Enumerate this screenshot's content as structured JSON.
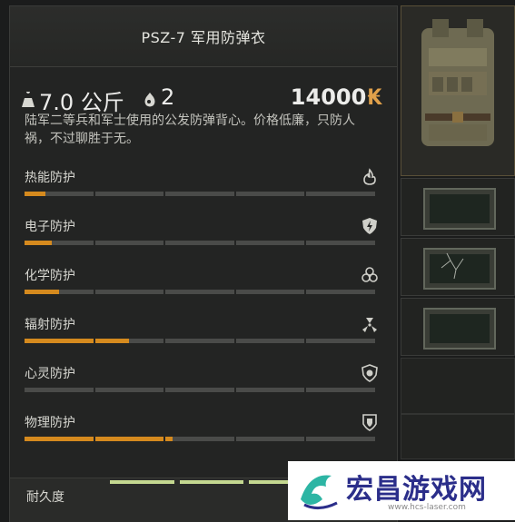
{
  "item": {
    "name": "PSZ-7 军用防弹衣",
    "weight": "7.0 公斤",
    "slots": "2",
    "price": "14000",
    "currency": "₭",
    "description": "陆军二等兵和军士使用的公发防弹背心。价格低廉，只防人祸，不过聊胜于无。"
  },
  "protections": [
    {
      "label": "热能防护",
      "icon": "flame-icon",
      "level": 0.06
    },
    {
      "label": "电子防护",
      "icon": "electric-shield-icon",
      "level": 0.08
    },
    {
      "label": "化学防护",
      "icon": "biohazard-icon",
      "level": 0.1
    },
    {
      "label": "辐射防护",
      "icon": "radiation-icon",
      "level": 0.3
    },
    {
      "label": "心灵防护",
      "icon": "psy-shield-icon",
      "level": 0.0
    },
    {
      "label": "物理防护",
      "icon": "armor-shield-icon",
      "level": 0.42
    }
  ],
  "durability": {
    "label": "耐久度",
    "level": 1.0
  },
  "colors": {
    "fill": "#d58a1e",
    "track": "#4a4b49",
    "durability": "#c4d890",
    "price_currency": "#e0a04a"
  },
  "watermark": {
    "text": "宏昌游戏网",
    "url": "www.hcs-laser.com"
  }
}
